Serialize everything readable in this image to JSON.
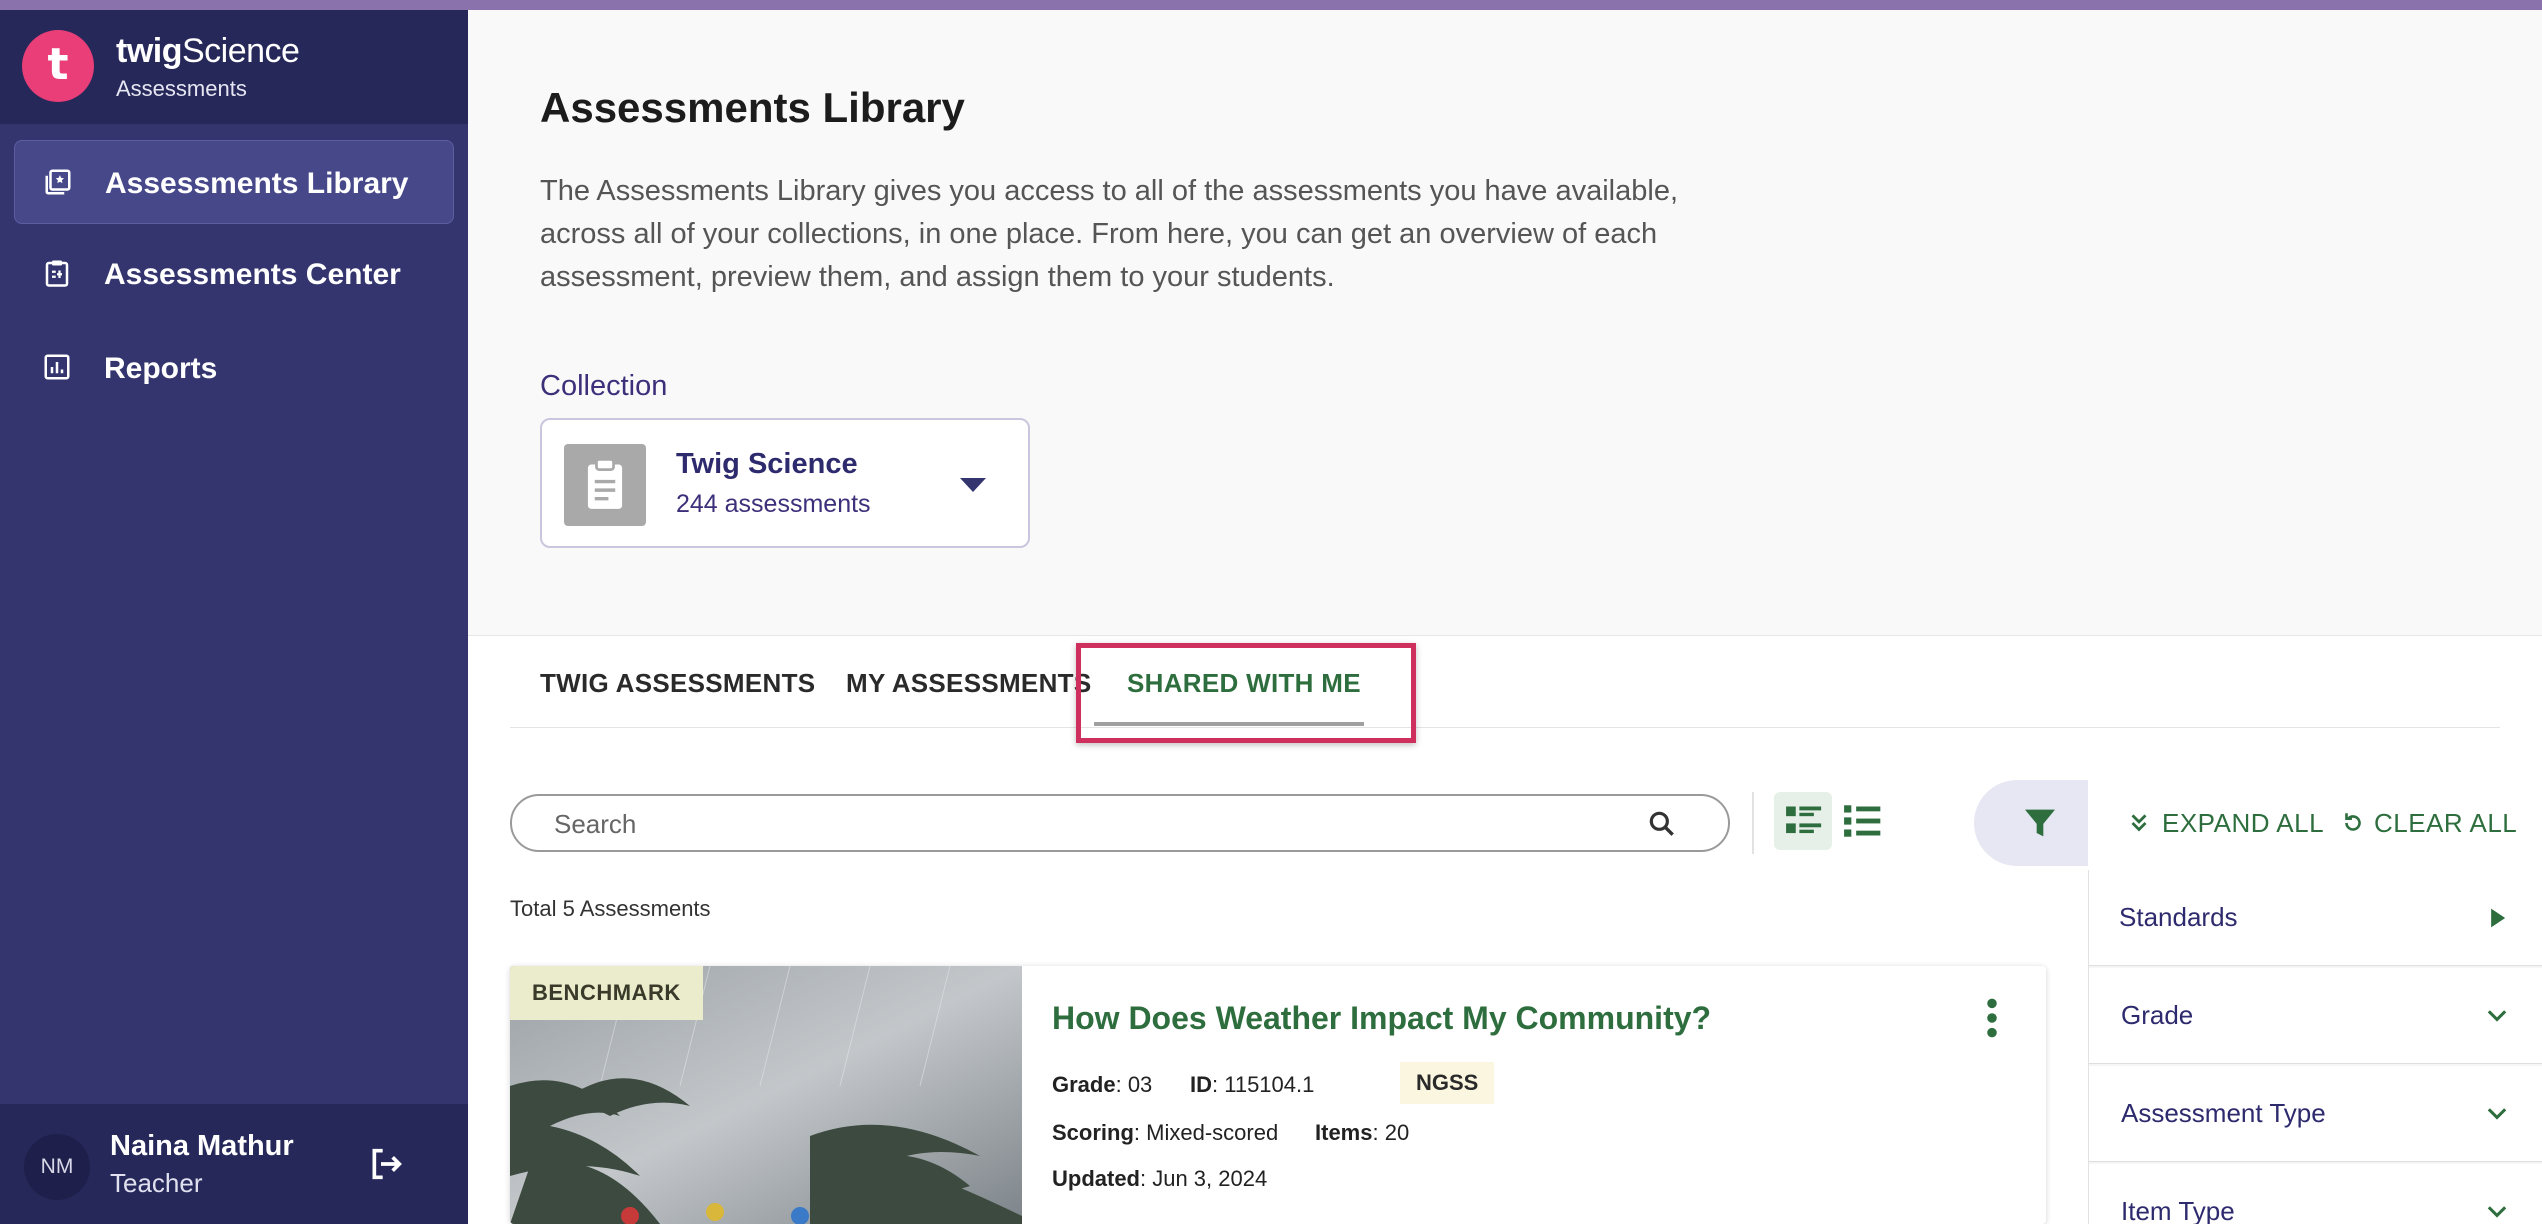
{
  "brand": {
    "logo_letter": "t",
    "name_prefix": "twig",
    "name_suffix": "Science",
    "subtitle": "Assessments"
  },
  "sidebar": {
    "items": [
      {
        "label": "Assessments Library",
        "icon": "library-icon",
        "active": true
      },
      {
        "label": "Assessments Center",
        "icon": "clipboard-icon",
        "active": false
      },
      {
        "label": "Reports",
        "icon": "bar-chart-icon",
        "active": false
      }
    ]
  },
  "user": {
    "initials": "NM",
    "name": "Naina Mathur",
    "role": "Teacher"
  },
  "header": {
    "title": "Assessments Library",
    "description": "The Assessments Library gives you access to all of the assessments you have available, across all of your collections, in one place. From here, you can get an overview of each assessment, preview them, and assign them to your students."
  },
  "collection": {
    "label": "Collection",
    "name": "Twig Science",
    "count": "244 assessments"
  },
  "tabs": [
    {
      "label": "TWIG ASSESSMENTS"
    },
    {
      "label": "MY ASSESSMENTS"
    },
    {
      "label": "SHARED WITH ME",
      "active": true
    }
  ],
  "search": {
    "placeholder": "Search",
    "value": ""
  },
  "results": {
    "total": "Total 5 Assessments"
  },
  "card": {
    "badge": "BENCHMARK",
    "title": "How Does Weather Impact My Community?",
    "grade_label": "Grade",
    "grade": ": 03",
    "id_label": "ID",
    "id": ": 115104.1",
    "standard": "NGSS",
    "scoring_label": "Scoring",
    "scoring": ": Mixed-scored",
    "items_label": "Items",
    "items": ": 20",
    "updated_label": "Updated",
    "updated": ": Jun 3, 2024"
  },
  "filters": {
    "expand_all": "EXPAND ALL",
    "clear_all": "CLEAR ALL",
    "sections": [
      {
        "label": "Standards",
        "icon": "play-arrow-icon"
      },
      {
        "label": "Grade",
        "icon": "chevron-down-icon"
      },
      {
        "label": "Assessment Type",
        "icon": "chevron-down-icon"
      },
      {
        "label": "Item Type",
        "icon": "chevron-down-icon"
      }
    ]
  },
  "colors": {
    "sidebar": "#34356f",
    "sidebar_dark": "#26285a",
    "brand_pink": "#e93e77",
    "accent_green": "#2e6e3e",
    "highlight": "#cf2f5c"
  }
}
